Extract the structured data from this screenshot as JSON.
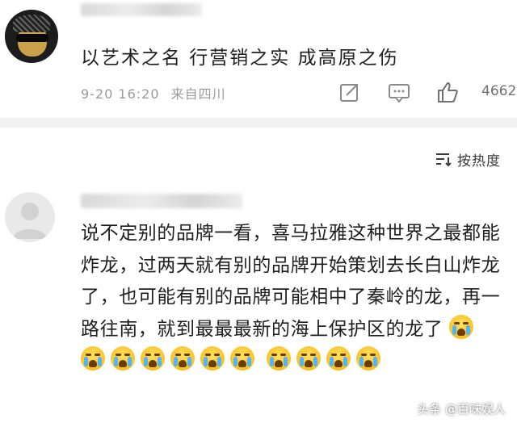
{
  "comment1": {
    "text": "以艺术之名 行营销之实 成高原之伤",
    "time": "9-20 16:20",
    "source": "来自四川",
    "likes": "4662",
    "icons": [
      "share-icon",
      "reply-icon",
      "like-icon"
    ]
  },
  "sort": {
    "label": "按热度",
    "icon": "sort-icon"
  },
  "comment2": {
    "text": "说不定别的品牌一看，喜马拉雅这种世界之最都能炸龙，过两天就有别的品牌开始策划去长白山炸龙了，也可能有别的品牌可能相中了秦岭的龙，再一路往南，就到最最最新的海上保护区的龙了",
    "emoji": [
      "crying-emoji",
      "crying-emoji",
      "crying-emoji",
      "crying-emoji",
      "crying-emoji",
      "crying-emoji",
      "crying-emoji",
      "crying-emoji",
      "crying-emoji",
      "crying-emoji",
      "crying-emoji"
    ]
  },
  "watermark": "头条 @百味娱人"
}
